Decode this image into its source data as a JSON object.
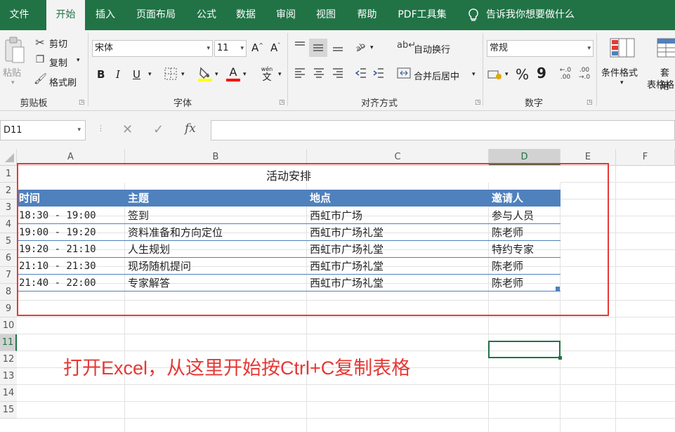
{
  "menu": {
    "tabs": [
      "文件",
      "开始",
      "插入",
      "页面布局",
      "公式",
      "数据",
      "审阅",
      "视图",
      "帮助",
      "PDF工具集"
    ],
    "active_tab": "开始",
    "tell_me": "告诉我你想要做什么"
  },
  "ribbon": {
    "clipboard": {
      "paste": "粘贴",
      "cut": "剪切",
      "copy": "复制",
      "format_painter": "格式刷",
      "label": "剪贴板"
    },
    "font": {
      "name": "宋体",
      "size": "11",
      "bold": "B",
      "italic": "I",
      "underline": "U",
      "wen_top": "wén",
      "wen_bottom": "文",
      "label": "字体",
      "grow": "A^",
      "shrink": "A˅",
      "font_color_glyph": "A",
      "underline_color": "#ff0000",
      "fill_color": "#ffff00"
    },
    "alignment": {
      "wrap_text": "自动换行",
      "merge_center": "合并后居中",
      "label": "对齐方式"
    },
    "number": {
      "format": "常规",
      "percent": "%",
      "comma": "9",
      "label": "数字",
      "dec_increase": "←.0 .00",
      "dec_decrease": ".00 →.0"
    },
    "styles": {
      "conditional_format": "条件格式",
      "table_format_top": "套用",
      "table_format_bottom": "表格格"
    }
  },
  "formula_bar": {
    "name_box": "D11",
    "cancel": "✕",
    "enter": "✓",
    "fx": "fx",
    "value": ""
  },
  "columns": [
    "A",
    "B",
    "C",
    "D",
    "E",
    "F"
  ],
  "rows": [
    "1",
    "2",
    "3",
    "4",
    "5",
    "6",
    "7",
    "8",
    "9",
    "10",
    "11",
    "12",
    "13",
    "14",
    "15"
  ],
  "sheet": {
    "title": "活动安排",
    "headers": [
      "时间",
      "主题",
      "地点",
      "邀请人"
    ],
    "header_color": "#4f81bd",
    "data": [
      [
        "18:30 - 19:00",
        "签到",
        "西虹市广场",
        "参与人员"
      ],
      [
        "19:00 - 19:20",
        "资料准备和方向定位",
        "西虹市广场礼堂",
        "陈老师"
      ],
      [
        "19:20 - 21:10",
        "人生规划",
        "西虹市广场礼堂",
        "特约专家"
      ],
      [
        "21:10 - 21:30",
        "现场随机提问",
        "西虹市广场礼堂",
        "陈老师"
      ],
      [
        "21:40 - 22:00",
        "专家解答",
        "西虹市广场礼堂",
        "陈老师"
      ]
    ]
  },
  "annotation": {
    "text": "打开Excel，从这里开始按Ctrl+C复制表格",
    "color": "#e53935"
  },
  "accent": "#217346"
}
